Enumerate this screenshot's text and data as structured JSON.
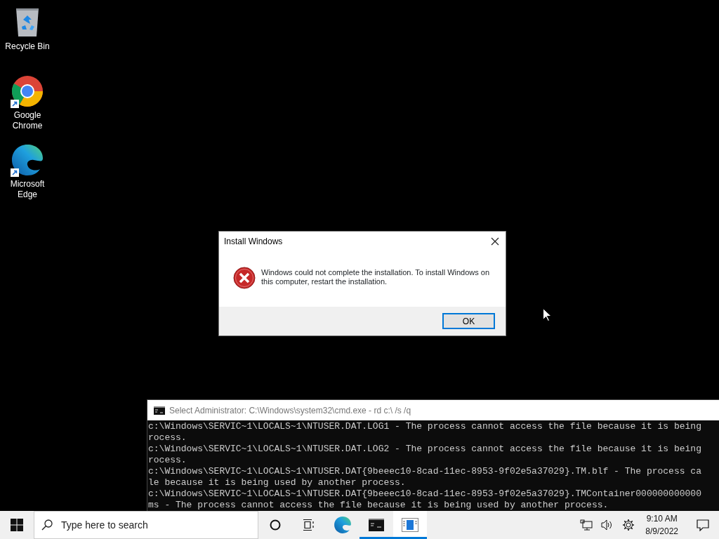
{
  "desktop_icons": [
    {
      "kind": "recycle-bin",
      "label": "Recycle Bin",
      "shortcut": false
    },
    {
      "kind": "chrome",
      "label": "Google Chrome",
      "shortcut": true
    },
    {
      "kind": "edge",
      "label": "Microsoft Edge",
      "shortcut": true
    }
  ],
  "dialog": {
    "title": "Install Windows",
    "message": "Windows could not complete the installation. To install Windows on this computer, restart the installation.",
    "buttons": [
      "OK"
    ]
  },
  "console": {
    "title": "Select Administrator: C:\\Windows\\system32\\cmd.exe - rd  c:\\ /s /q",
    "lines": [
      "c:\\Windows\\SERVIC~1\\LOCALS~1\\NTUSER.DAT.LOG1 - The process cannot access the file because it is being",
      "rocess.",
      "c:\\Windows\\SERVIC~1\\LOCALS~1\\NTUSER.DAT.LOG2 - The process cannot access the file because it is being",
      "rocess.",
      "c:\\Windows\\SERVIC~1\\LOCALS~1\\NTUSER.DAT{9beeec10-8cad-11ec-8953-9f02e5a37029}.TM.blf - The process ca",
      "le because it is being used by another process.",
      "c:\\Windows\\SERVIC~1\\LOCALS~1\\NTUSER.DAT{9beeec10-8cad-11ec-8953-9f02e5a37029}.TMContainer000000000000",
      "ms - The process cannot access the file because it is being used by another process."
    ]
  },
  "taskbar": {
    "search": {
      "placeholder": "Type here to search"
    },
    "apps": [
      {
        "kind": "edge",
        "running": false,
        "active": false
      },
      {
        "kind": "cmd",
        "running": true,
        "active": false
      },
      {
        "kind": "setup",
        "running": true,
        "active": true
      }
    ],
    "time": "9:10 AM",
    "date": "8/9/2022"
  }
}
